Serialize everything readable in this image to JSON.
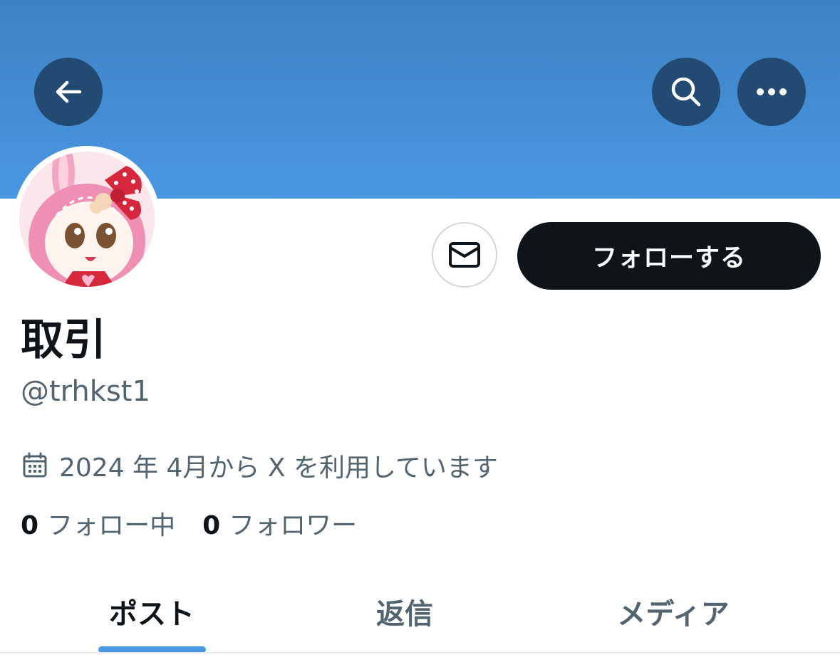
{
  "header": {
    "back_icon": "back-arrow-icon",
    "search_icon": "search-icon",
    "more_icon": "more-horizontal-icon",
    "banner_color": "#4a97e2"
  },
  "profile": {
    "display_name": "取引",
    "handle": "@trhkst1",
    "joined": "2024 年 4月から X を利用しています",
    "follow_button_label": "フォローする",
    "message_icon": "envelope-icon"
  },
  "stats": {
    "following_count": "0",
    "following_label": "フォロー中",
    "followers_count": "0",
    "followers_label": "フォロワー"
  },
  "tabs": [
    {
      "label": "ポスト",
      "active": true
    },
    {
      "label": "返信",
      "active": false
    },
    {
      "label": "メディア",
      "active": false
    }
  ],
  "colors": {
    "accent": "#4a97e2",
    "text_primary": "#0f1419",
    "text_secondary": "#536471",
    "header_button": "#224a72"
  }
}
